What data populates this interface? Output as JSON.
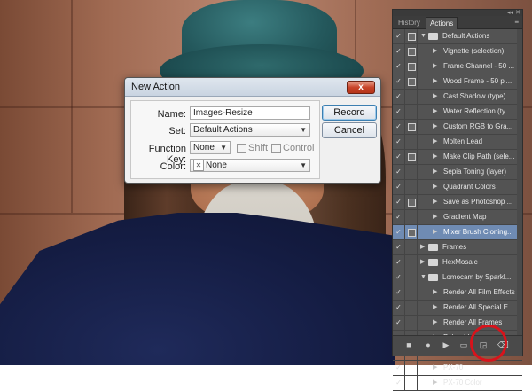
{
  "dialog": {
    "title": "New Action",
    "close_label": "x",
    "name_label": "Name:",
    "name_value": "Images-Resize",
    "set_label": "Set:",
    "set_value": "Default Actions",
    "function_key_label": "Function Key:",
    "function_key_value": "None",
    "shift_label": "Shift",
    "control_label": "Control",
    "color_label": "Color:",
    "color_value": "None",
    "record_label": "Record",
    "cancel_label": "Cancel"
  },
  "panel": {
    "tabs": [
      "History",
      "Actions"
    ],
    "active_tab": "Actions",
    "items": [
      {
        "label": "Default Actions",
        "kind": "set",
        "expanded": true,
        "checked": true,
        "dialog": true
      },
      {
        "label": "Vignette (selection)",
        "kind": "action",
        "checked": true,
        "dialog": true
      },
      {
        "label": "Frame Channel - 50 ...",
        "kind": "action",
        "checked": true,
        "dialog": true
      },
      {
        "label": "Wood Frame - 50 pi...",
        "kind": "action",
        "checked": true,
        "dialog": true
      },
      {
        "label": "Cast Shadow (type)",
        "kind": "action",
        "checked": true,
        "dialog": false
      },
      {
        "label": "Water Reflection (ty...",
        "kind": "action",
        "checked": true,
        "dialog": false
      },
      {
        "label": "Custom RGB to Gra...",
        "kind": "action",
        "checked": true,
        "dialog": true
      },
      {
        "label": "Molten Lead",
        "kind": "action",
        "checked": true,
        "dialog": false
      },
      {
        "label": "Make Clip Path (sele...",
        "kind": "action",
        "checked": true,
        "dialog": true
      },
      {
        "label": "Sepia Toning (layer)",
        "kind": "action",
        "checked": true,
        "dialog": false
      },
      {
        "label": "Quadrant Colors",
        "kind": "action",
        "checked": true,
        "dialog": false
      },
      {
        "label": "Save as Photoshop ...",
        "kind": "action",
        "checked": true,
        "dialog": true
      },
      {
        "label": "Gradient Map",
        "kind": "action",
        "checked": true,
        "dialog": false
      },
      {
        "label": "Mixer Brush Cloning...",
        "kind": "action",
        "checked": true,
        "dialog": true,
        "selected": true
      },
      {
        "label": "Frames",
        "kind": "set",
        "expanded": false,
        "checked": true,
        "dialog": false
      },
      {
        "label": "HexMosaic",
        "kind": "set",
        "expanded": false,
        "checked": true,
        "dialog": false
      },
      {
        "label": "Lomocam by Sparkl...",
        "kind": "set",
        "expanded": true,
        "checked": true,
        "dialog": false
      },
      {
        "label": "Render All Film Effects",
        "kind": "action",
        "checked": true,
        "dialog": false
      },
      {
        "label": "Render All Special E...",
        "kind": "action",
        "checked": true,
        "dialog": false
      },
      {
        "label": "Render All Frames",
        "kind": "action",
        "checked": true,
        "dialog": false
      },
      {
        "label": "Polaroid",
        "kind": "action",
        "checked": true,
        "dialog": false
      },
      {
        "label": "Mega Contrast",
        "kind": "action",
        "checked": true,
        "dialog": false
      },
      {
        "label": "PX-70",
        "kind": "action",
        "checked": true,
        "dialog": false
      },
      {
        "label": "PX-70 Color",
        "kind": "action",
        "checked": true,
        "dialog": false
      }
    ],
    "footer_buttons": [
      "stop-icon",
      "record-icon",
      "play-icon",
      "new-set-icon",
      "new-action-icon",
      "delete-icon"
    ]
  },
  "colors": {
    "highlight_circle": "#d8131b",
    "selected_row": "#6f8bb3",
    "panel_bg": "#535353"
  }
}
